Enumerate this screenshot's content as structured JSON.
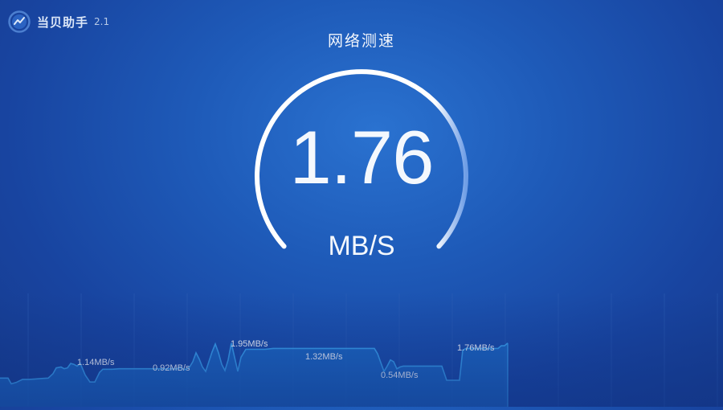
{
  "app": {
    "name": "当贝助手",
    "version": "2.1"
  },
  "page": {
    "title": "网络测速"
  },
  "gauge": {
    "value": "1.76",
    "unit": "MB/S"
  },
  "chart_data": {
    "type": "area",
    "x": [
      0,
      10,
      14,
      20,
      28,
      36,
      44,
      52,
      60,
      66,
      70,
      76,
      80,
      84,
      88,
      92,
      96,
      100,
      106,
      112,
      118,
      124,
      128,
      134,
      140,
      148,
      156,
      164,
      172,
      180,
      190,
      200,
      210,
      220,
      224,
      230,
      236,
      240,
      244,
      248,
      252,
      256,
      260,
      264,
      268,
      272,
      276,
      280,
      284,
      288,
      292,
      296,
      300,
      306,
      312,
      318,
      324,
      330,
      340,
      350,
      360,
      370,
      380,
      390,
      400,
      410,
      420,
      430,
      440,
      450,
      460,
      466,
      470,
      474,
      478,
      482,
      486,
      490,
      494,
      498,
      502,
      506,
      510,
      514,
      518,
      522,
      526,
      530,
      534,
      538,
      542,
      546,
      550,
      556,
      560,
      564,
      568,
      572,
      576,
      580,
      584,
      588,
      592,
      596,
      600,
      604,
      608,
      612,
      616,
      620,
      624,
      628,
      632
    ],
    "values": [
      0.65,
      0.65,
      0.52,
      0.55,
      0.62,
      0.62,
      0.63,
      0.64,
      0.65,
      0.75,
      0.88,
      0.9,
      0.86,
      0.88,
      0.98,
      0.96,
      0.92,
      0.98,
      0.72,
      0.56,
      0.56,
      0.78,
      0.85,
      0.85,
      0.85,
      0.86,
      0.86,
      0.86,
      0.86,
      0.86,
      0.86,
      0.86,
      0.86,
      0.86,
      0.9,
      0.84,
      0.9,
      1.02,
      1.22,
      1.08,
      0.9,
      0.8,
      1.02,
      1.24,
      1.42,
      1.22,
      0.96,
      0.82,
      1.06,
      1.44,
      1.12,
      0.8,
      1.12,
      1.3,
      1.3,
      1.3,
      1.3,
      1.3,
      1.32,
      1.32,
      1.32,
      1.32,
      1.32,
      1.32,
      1.32,
      1.32,
      1.32,
      1.32,
      1.32,
      1.32,
      1.32,
      1.32,
      1.2,
      1.0,
      0.8,
      0.92,
      1.06,
      1.02,
      0.86,
      0.9,
      0.92,
      0.92,
      0.92,
      0.92,
      0.92,
      0.92,
      0.92,
      0.92,
      0.92,
      0.92,
      0.92,
      0.92,
      0.92,
      0.6,
      0.6,
      0.6,
      0.6,
      0.6,
      1.28,
      1.32,
      1.32,
      1.32,
      1.32,
      1.32,
      1.32,
      1.32,
      1.32,
      1.32,
      1.32,
      1.32,
      1.38,
      1.38,
      1.44
    ],
    "labels": [
      {
        "text": "1.14MB/s",
        "x": 96
      },
      {
        "text": "0.92MB/s",
        "x": 190
      },
      {
        "text": "1.95MB/s",
        "x": 287
      },
      {
        "text": "1.32MB/s",
        "x": 380
      },
      {
        "text": "0.54MB/s",
        "x": 474
      },
      {
        "text": "1.76MB/s",
        "x": 569
      }
    ],
    "ylim": [
      0,
      2.2
    ],
    "colors": {
      "line": "#3aa3f0",
      "fill": "#1d6fc9",
      "grid": "#2f5fb5"
    }
  }
}
